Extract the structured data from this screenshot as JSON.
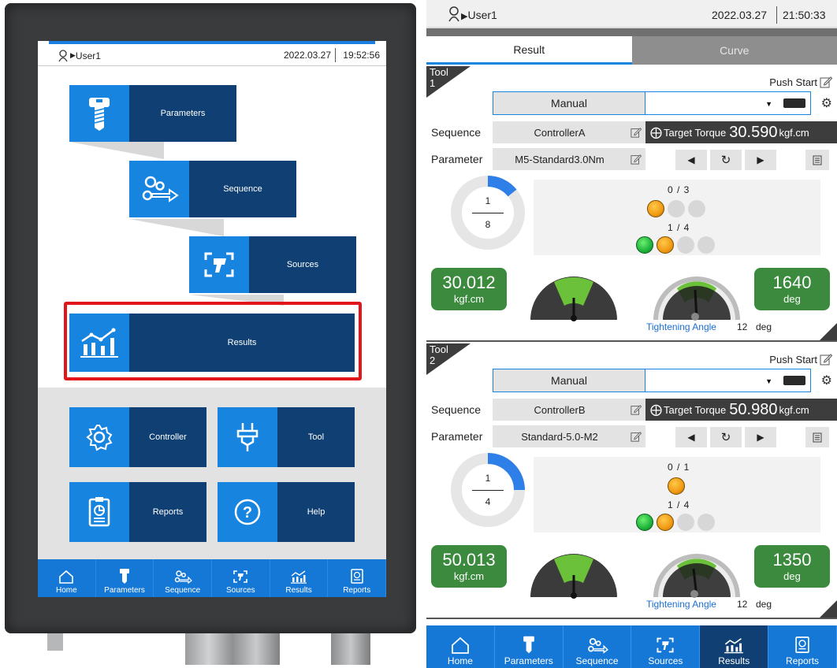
{
  "left_device": {
    "status": {
      "user": "User1",
      "date": "2022.03.27",
      "time": "19:52:56"
    },
    "menu": {
      "parameters": "Parameters",
      "sequence": "Sequence",
      "sources": "Sources",
      "results": "Results",
      "controller": "Controller",
      "tool": "Tool",
      "reports": "Reports",
      "help": "Help"
    },
    "nav": [
      "Home",
      "Parameters",
      "Sequence",
      "Sources",
      "Results",
      "Reports"
    ]
  },
  "right_panel": {
    "status": {
      "user": "User1",
      "date": "2022.03.27",
      "time": "21:50:33"
    },
    "tabs": {
      "result": "Result",
      "curve": "Curve"
    },
    "common": {
      "push_start": "Push Start",
      "sequence_label": "Sequence",
      "parameter_label": "Parameter",
      "target_label": "Target Torque",
      "angle_label": "Tightening Angle",
      "angle_unit": "deg"
    },
    "tools": [
      {
        "name": "Tool",
        "number": "1",
        "mode": "Manual",
        "sequence": "ControllerA",
        "parameter": "M5-Standard3.0Nm",
        "target_value": "30.590",
        "target_unit": "kgf.cm",
        "count_num": "1",
        "count_den": "8",
        "frac_top": "0 / 3",
        "frac_bottom": "1 / 4",
        "torque": "30.012",
        "torque_unit": "kgf.cm",
        "angle": "1640",
        "angle_box_unit": "deg",
        "tightening_angle": "12"
      },
      {
        "name": "Tool",
        "number": "2",
        "mode": "Manual",
        "sequence": "ControllerB",
        "parameter": "Standard-5.0-M2",
        "target_value": "50.980",
        "target_unit": "kgf.cm",
        "count_num": "1",
        "count_den": "4",
        "frac_top": "0 / 1",
        "frac_bottom": "1 / 4",
        "torque": "50.013",
        "torque_unit": "kgf.cm",
        "angle": "1350",
        "angle_box_unit": "deg",
        "tightening_angle": "12"
      }
    ],
    "nav": [
      "Home",
      "Parameters",
      "Sequence",
      "Sources",
      "Results",
      "Reports"
    ]
  },
  "colors": {
    "accent": "#1785e0",
    "navy": "#0f3f73",
    "highlight": "#e0161a",
    "ok_green": "#3b8a3e"
  }
}
